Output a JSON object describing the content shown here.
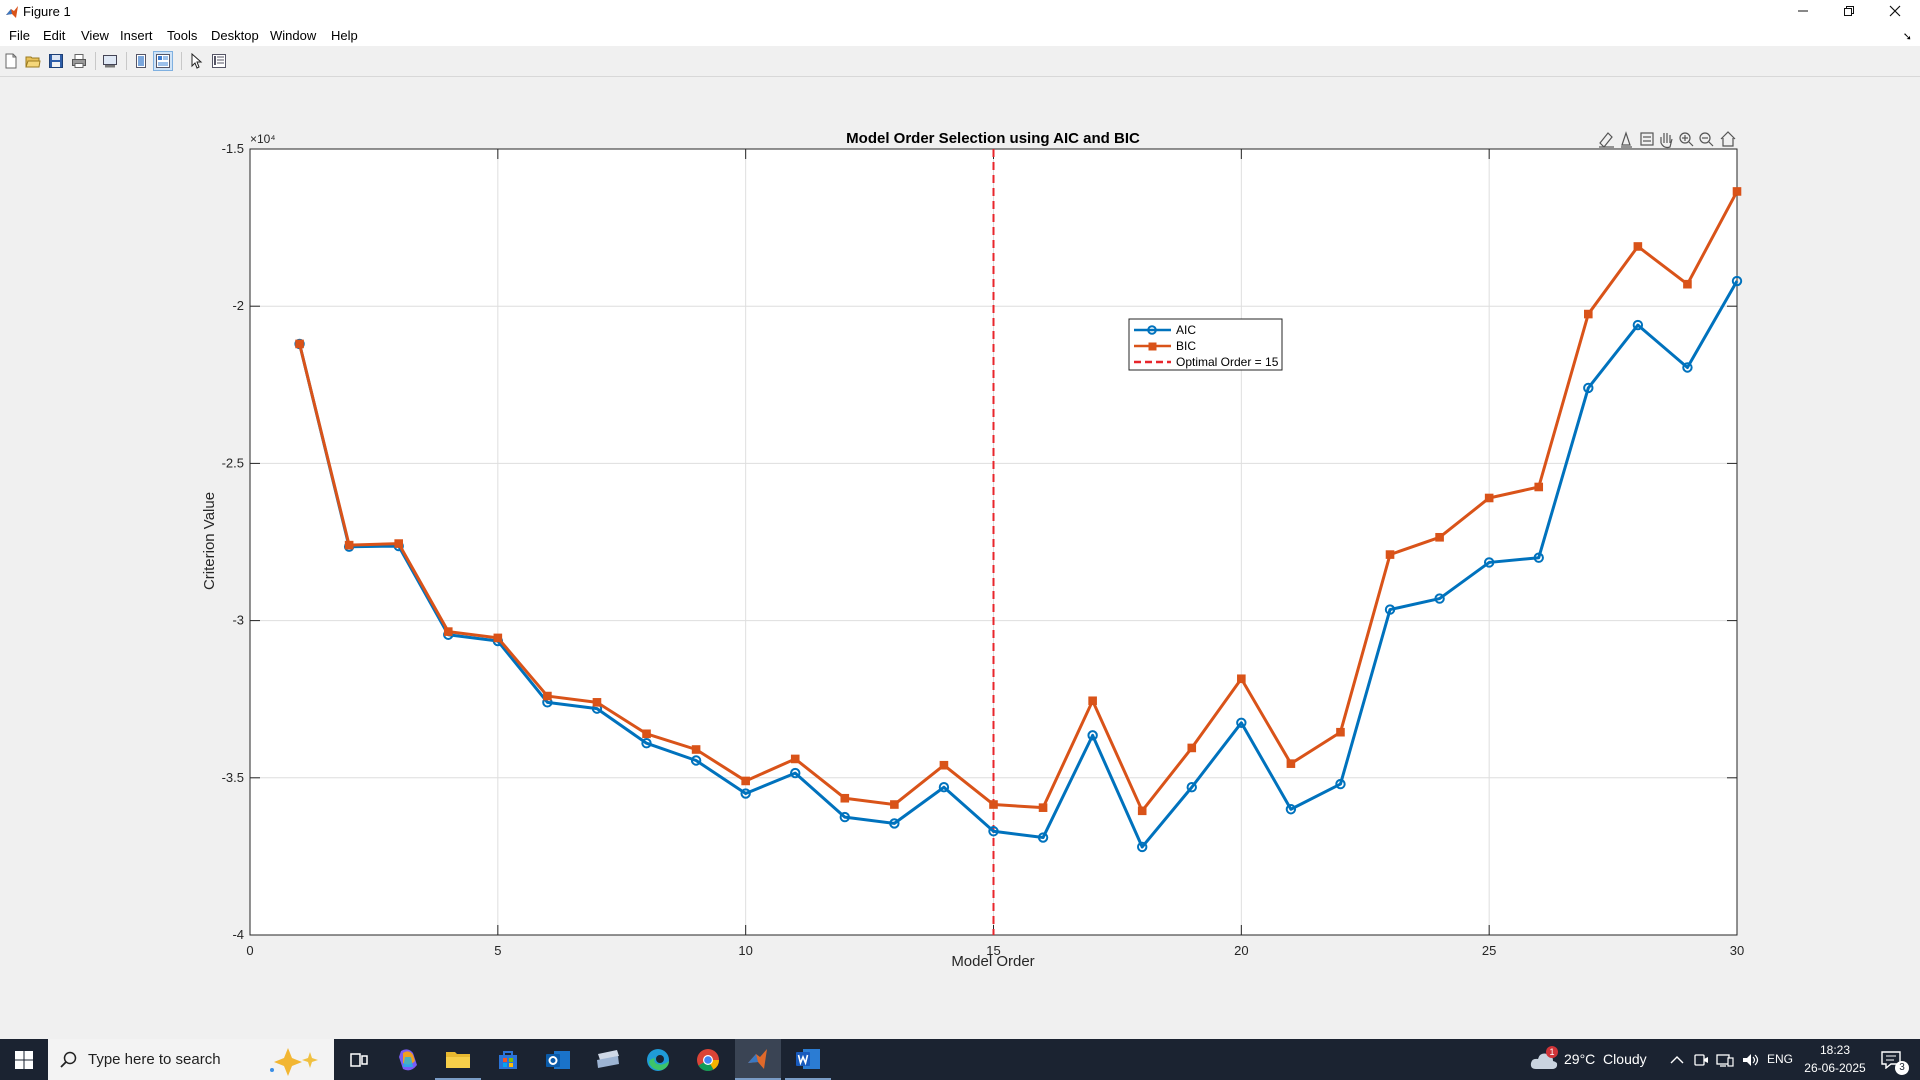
{
  "window": {
    "title": "Figure 1"
  },
  "menu": [
    "File",
    "Edit",
    "View",
    "Insert",
    "Tools",
    "Desktop",
    "Window",
    "Help"
  ],
  "toolbar_icons": [
    "new-figure-icon",
    "open-file-icon",
    "save-icon",
    "print-icon",
    "link-plot-icon",
    "hide-plot-tools-icon",
    "show-plot-tools-icon",
    "edit-plot-icon",
    "property-inspector-icon"
  ],
  "axes_toolbar_icons": [
    "brush-icon",
    "data-tips-icon",
    "restore-view-icon",
    "pan-icon",
    "zoom-in-icon",
    "zoom-out-icon",
    "home-icon"
  ],
  "chart_data": {
    "type": "line",
    "title": "Model Order Selection using AIC and BIC",
    "xlabel": "Model Order",
    "ylabel": "Criterion Value",
    "exponent_label": "×10⁴",
    "xlim": [
      0,
      30
    ],
    "ylim": [
      -4,
      -1.5
    ],
    "y_scale_factor": 10000,
    "xticks": [
      0,
      5,
      10,
      15,
      20,
      25,
      30
    ],
    "yticks": [
      -4,
      -3.5,
      -3,
      -2.5,
      -2,
      -1.5
    ],
    "ytick_labels": [
      "-4",
      "-3.5",
      "-3",
      "-2.5",
      "-2",
      "-1.5"
    ],
    "grid": true,
    "legend_position": "upper-middle",
    "x": [
      1,
      2,
      3,
      4,
      5,
      6,
      7,
      8,
      9,
      10,
      11,
      12,
      13,
      14,
      15,
      16,
      17,
      18,
      19,
      20,
      21,
      22,
      23,
      24,
      25,
      26,
      27,
      28,
      29,
      30
    ],
    "series": [
      {
        "name": "AIC",
        "color": "#0072BD",
        "marker": "circle",
        "values": [
          -2.12,
          -2.765,
          -2.763,
          -3.045,
          -3.065,
          -3.26,
          -3.28,
          -3.39,
          -3.445,
          -3.55,
          -3.485,
          -3.625,
          -3.645,
          -3.53,
          -3.67,
          -3.69,
          -3.365,
          -3.72,
          -3.53,
          -3.325,
          -3.6,
          -3.52,
          -2.965,
          -2.93,
          -2.815,
          -2.8,
          -2.26,
          -2.06,
          -2.195,
          -1.92
        ]
      },
      {
        "name": "BIC",
        "color": "#D95319",
        "marker": "square",
        "values": [
          -2.12,
          -2.76,
          -2.755,
          -3.035,
          -3.055,
          -3.24,
          -3.26,
          -3.36,
          -3.41,
          -3.51,
          -3.44,
          -3.565,
          -3.585,
          -3.46,
          -3.585,
          -3.595,
          -3.255,
          -3.605,
          -3.405,
          -3.185,
          -3.455,
          -3.355,
          -2.79,
          -2.735,
          -2.61,
          -2.575,
          -2.025,
          -1.81,
          -1.93,
          -1.635
        ]
      }
    ],
    "vline": {
      "x": 15,
      "name": "Optimal Order = 15",
      "color": "#E8252B",
      "style": "dashed"
    }
  },
  "taskbar": {
    "search_placeholder": "Type here to search",
    "weather": "29°C  Cloudy",
    "weather_badge": "1",
    "language": "ENG",
    "time": "18:23",
    "date": "26-06-2025",
    "notification_count": "3"
  }
}
